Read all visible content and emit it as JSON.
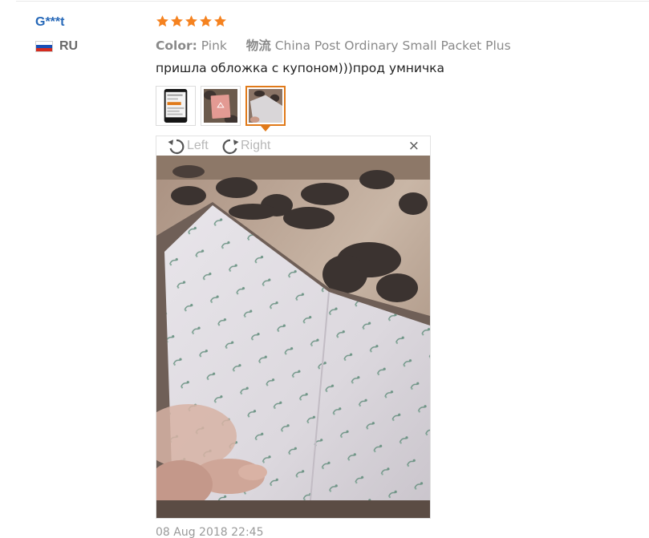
{
  "review": {
    "buyer_name": "G***t",
    "country_code": "RU",
    "flag_icon": "russia-flag-icon",
    "rating": 5,
    "star_color": "#f5821f",
    "attributes": {
      "color_label": "Color:",
      "color_value": "Pink",
      "shipping_label": "物流",
      "shipping_value": "China Post Ordinary Small Packet Plus"
    },
    "text": "пришла обложка с купоном)))прод умничка",
    "thumbnails": [
      {
        "name": "phone-screenshot-thumbnail",
        "active": false
      },
      {
        "name": "pink-cover-thumbnail",
        "active": false
      },
      {
        "name": "cover-photo-thumbnail",
        "active": true
      }
    ],
    "viewer": {
      "rotate_left_label": "Left",
      "rotate_right_label": "Right",
      "close_label": "×"
    },
    "date": "08 Aug 2018 22:45"
  },
  "colors": {
    "accent": "#e07a1a",
    "link": "#2668b8"
  }
}
